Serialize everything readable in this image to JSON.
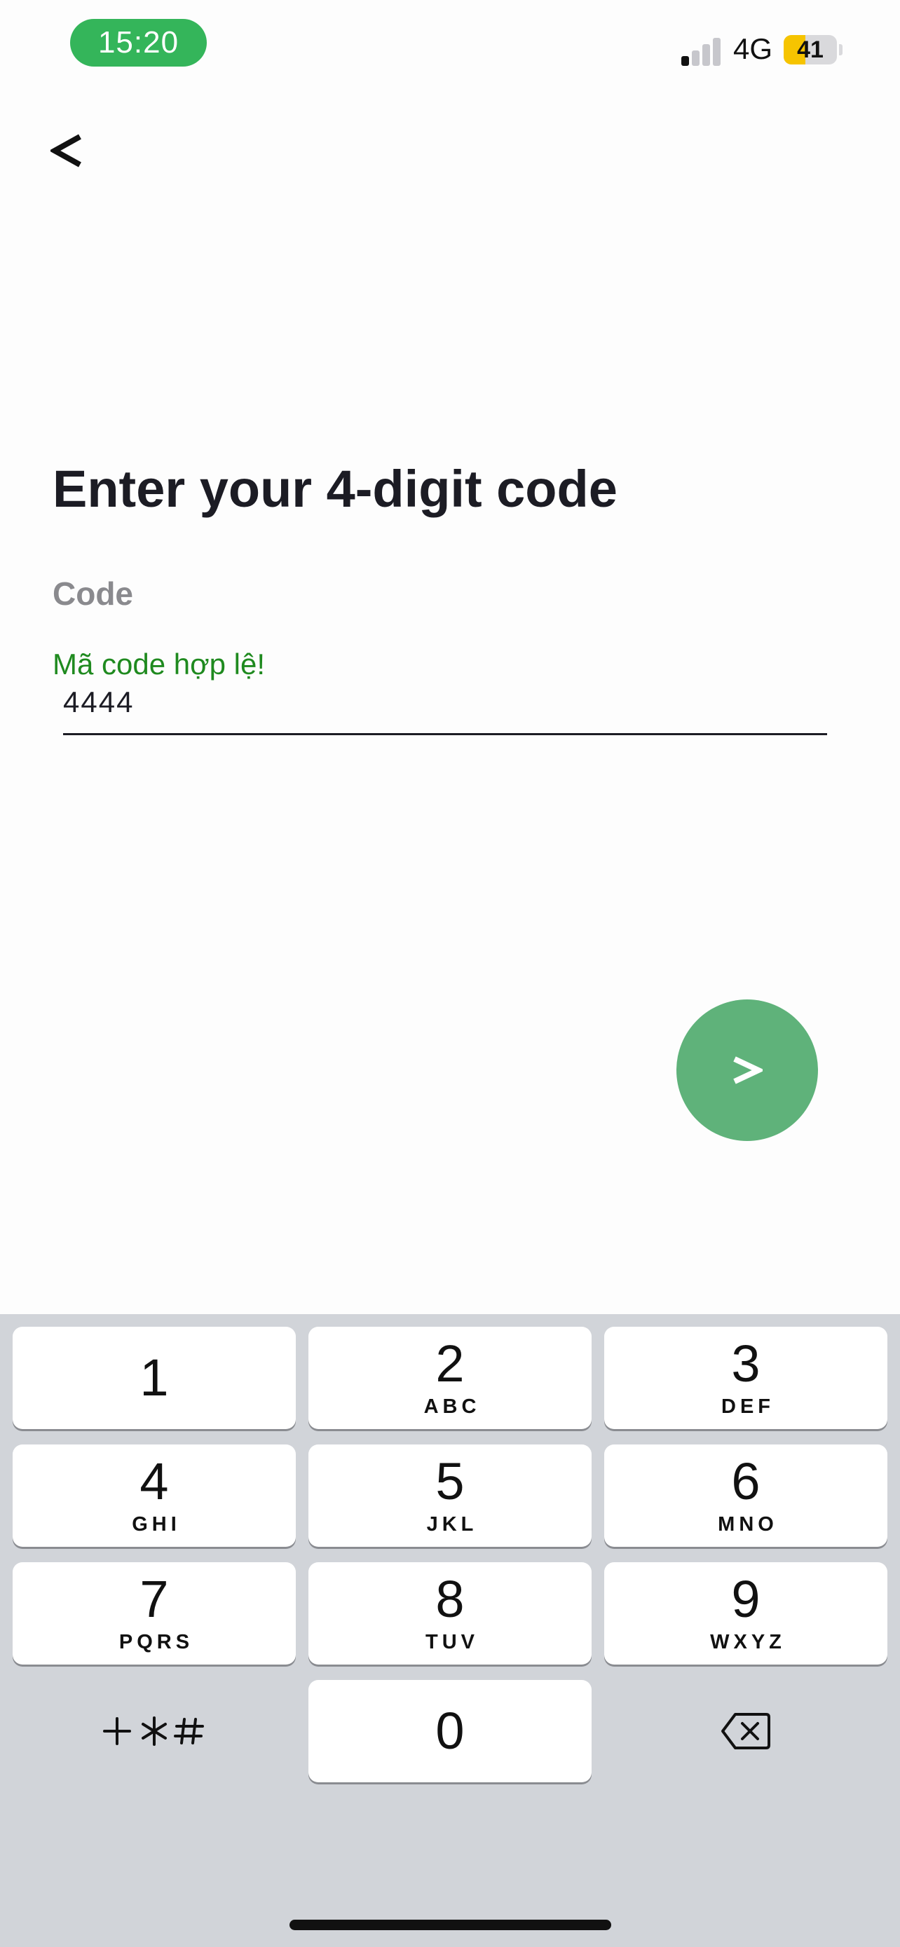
{
  "status_bar": {
    "time": "15:20",
    "network": "4G",
    "battery_level": "41",
    "signal_bars_active": 1,
    "signal_bars_total": 4
  },
  "header": {
    "back_icon": "chevron-left-icon"
  },
  "main": {
    "title": "Enter your 4-digit code",
    "code_label": "Code",
    "validation_message": "Mã code hợp lệ!",
    "code_value": "4444",
    "next_icon": "chevron-right-icon"
  },
  "keyboard": {
    "keys": [
      {
        "digit": "1",
        "letters": ""
      },
      {
        "digit": "2",
        "letters": "ABC"
      },
      {
        "digit": "3",
        "letters": "DEF"
      },
      {
        "digit": "4",
        "letters": "GHI"
      },
      {
        "digit": "5",
        "letters": "JKL"
      },
      {
        "digit": "6",
        "letters": "MNO"
      },
      {
        "digit": "7",
        "letters": "PQRS"
      },
      {
        "digit": "8",
        "letters": "TUV"
      },
      {
        "digit": "9",
        "letters": "WXYZ"
      },
      {
        "digit": "0",
        "letters": ""
      }
    ],
    "symbols_key": "+*#",
    "delete_icon": "backspace-icon"
  },
  "colors": {
    "accent_green": "#34b55a",
    "button_green": "#5fb27a",
    "valid_text": "#1f8a1f",
    "battery_yellow": "#f6c400"
  }
}
